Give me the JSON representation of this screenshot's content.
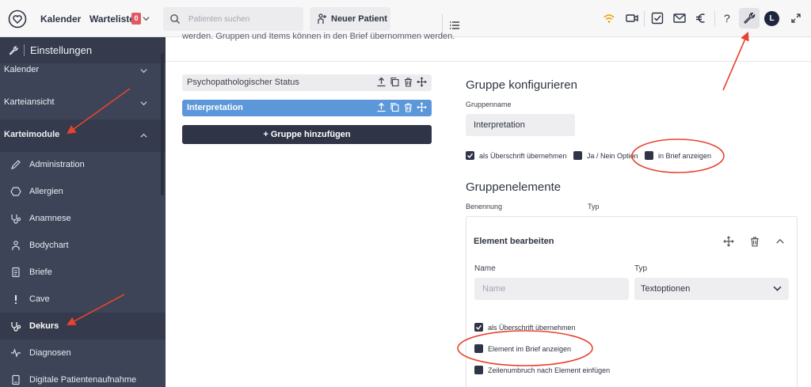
{
  "topbar": {
    "logo": "heart-logo-icon",
    "calendar_label": "Kalender",
    "waitlist_label": "Warteliste",
    "waitlist_count": "0",
    "search_placeholder": "Patienten suchen",
    "new_patient_label": "Neuer Patient",
    "help_label": "?",
    "avatar_initial": "L",
    "icons": [
      "wifi-icon",
      "video-icon",
      "tasks-icon",
      "mail-icon",
      "euro-icon",
      "help-icon",
      "wrench-icon",
      "expand-icon"
    ],
    "wifi_color": "#f0a500"
  },
  "sidebar": {
    "title": "Einstellungen",
    "sections": [
      {
        "label": "Kalender",
        "expanded": false
      },
      {
        "label": "Karteiansicht",
        "expanded": false
      },
      {
        "label": "Karteimodule",
        "expanded": true
      }
    ],
    "items": [
      {
        "label": "Administration",
        "icon": "pencil-icon"
      },
      {
        "label": "Allergien",
        "icon": "hexagon-icon"
      },
      {
        "label": "Anamnese",
        "icon": "stethoscope-icon"
      },
      {
        "label": "Bodychart",
        "icon": "person-icon"
      },
      {
        "label": "Briefe",
        "icon": "document-icon"
      },
      {
        "label": "Cave",
        "icon": "exclamation-icon"
      },
      {
        "label": "Dekurs",
        "icon": "stethoscope-icon",
        "active": true
      },
      {
        "label": "Diagnosen",
        "icon": "pulse-icon"
      },
      {
        "label": "Digitale Patientenaufnahme",
        "icon": "tablet-icon"
      }
    ]
  },
  "main": {
    "cut_text": "werden. Gruppen und Items können in den Brief übernommen werden.",
    "groups": [
      {
        "name": "Psychopathologischer Status",
        "selected": false
      },
      {
        "name": "Interpretation",
        "selected": true
      }
    ],
    "add_group_label": "+ Gruppe hinzufügen",
    "config": {
      "heading": "Gruppe konfigurieren",
      "groupname_label": "Gruppenname",
      "groupname_value": "Interpretation",
      "options": [
        {
          "label": "als Überschrift übernehmen",
          "checked": true
        },
        {
          "label": "Ja / Nein Option",
          "checked": false
        },
        {
          "label": "in Brief anzeigen",
          "checked": false
        }
      ]
    },
    "elements": {
      "heading": "Gruppenelemente",
      "col_name": "Benennung",
      "col_type": "Typ",
      "edit": {
        "title": "Element bearbeiten",
        "name_label": "Name",
        "name_placeholder": "Name",
        "type_label": "Typ",
        "type_value": "Textoptionen",
        "options": [
          {
            "label": "als Überschrift übernehmen",
            "checked": true
          },
          {
            "label": "Element im Brief anzeigen",
            "checked": false
          },
          {
            "label": "Zeilenumbruch nach Element einfügen",
            "checked": false
          }
        ]
      }
    }
  },
  "colors": {
    "sidebar_bg": "#3d4457",
    "accent_blue": "#5b97d9",
    "dark_button": "#2f3446",
    "annotation_red": "#e8432e",
    "badge_red": "#e05a62"
  }
}
